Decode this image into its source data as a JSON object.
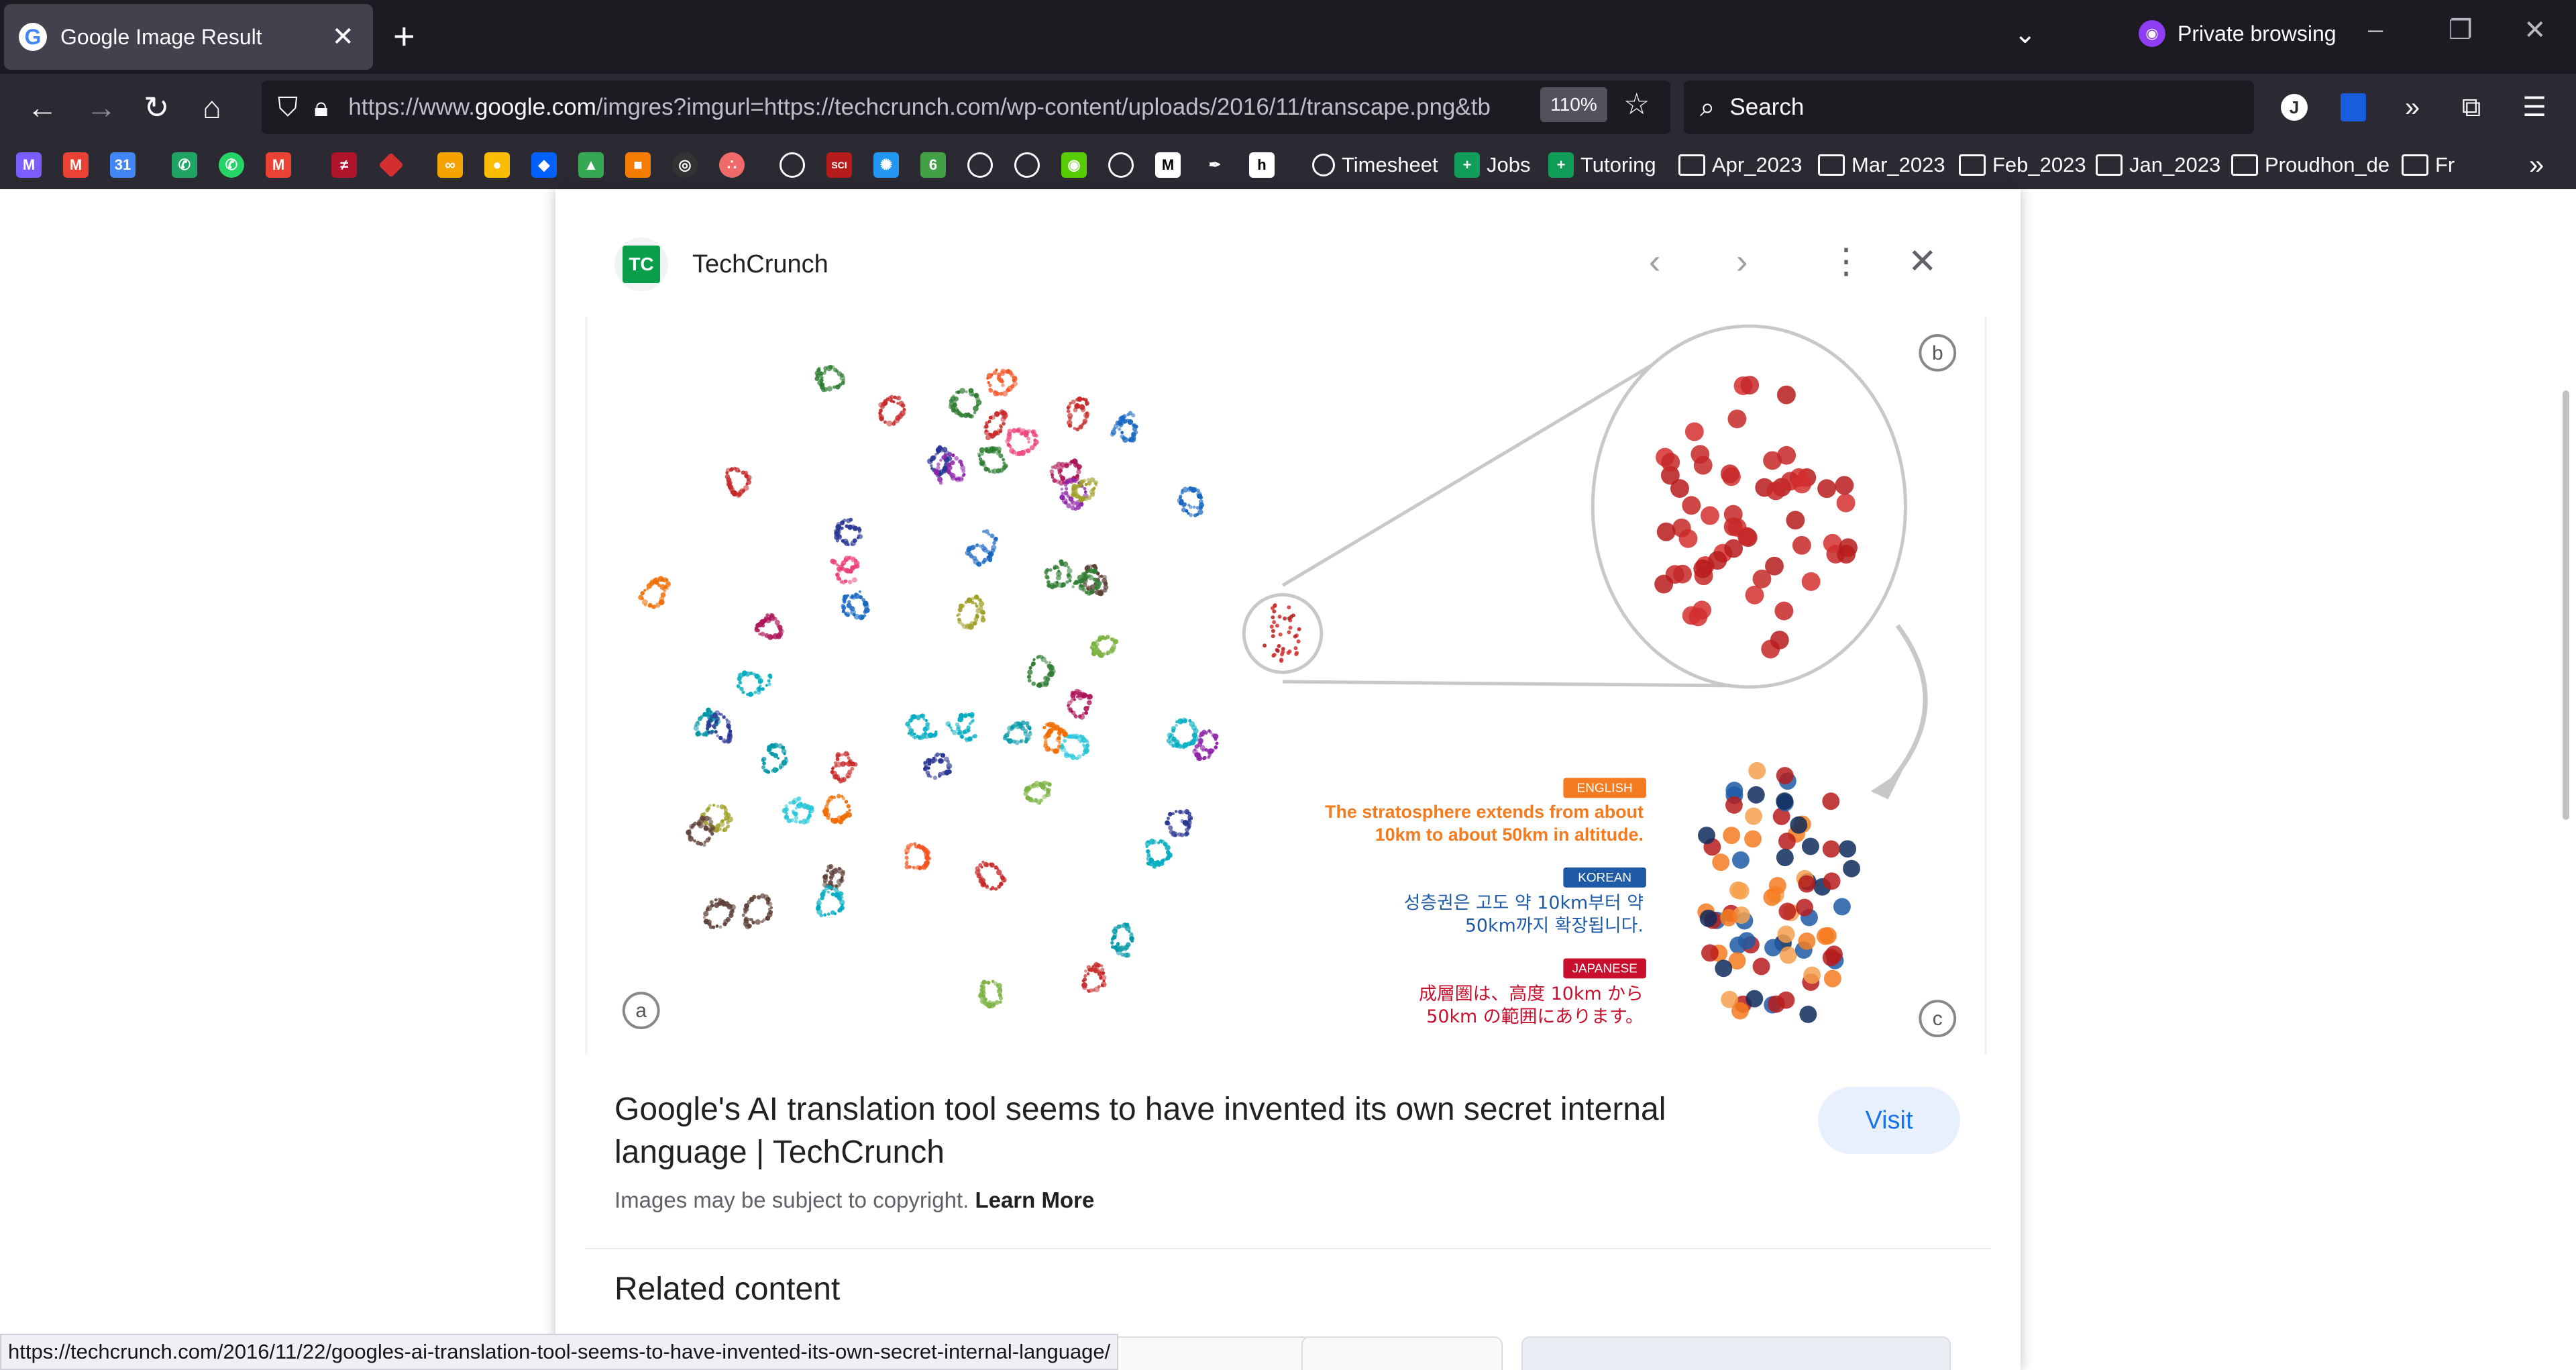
{
  "browser": {
    "tab_title": "Google Image Result",
    "tab_close": "✕",
    "new_tab": "+",
    "private_label": "Private browsing",
    "url_prefix": "https://www.",
    "url_domain": "google.com",
    "url_rest": "/imgres?imgurl=https://techcrunch.com/wp-content/uploads/2016/11/transcape.png&tb",
    "zoom": "110%",
    "search_placeholder": "Search",
    "bookmarks": [
      {
        "label": "Timesheet",
        "type": "globe"
      },
      {
        "label": "Jobs",
        "type": "sheet"
      },
      {
        "label": "Tutoring",
        "type": "sheet"
      },
      {
        "label": "Apr_2023",
        "type": "folder"
      },
      {
        "label": "Mar_2023",
        "type": "folder"
      },
      {
        "label": "Feb_2023",
        "type": "folder"
      },
      {
        "label": "Jan_2023",
        "type": "folder"
      },
      {
        "label": "Proudhon_de",
        "type": "folder"
      },
      {
        "label": "Fr",
        "type": "folder"
      }
    ],
    "status_url": "https://techcrunch.com/2016/11/22/googles-ai-translation-tool-seems-to-have-invented-its-own-secret-internal-language/"
  },
  "card": {
    "source_name": "TechCrunch",
    "source_logo_text": "TC",
    "headline": "Google's AI translation tool seems to have invented its own secret internal language | TechCrunch",
    "visit_label": "Visit",
    "copyright_text": "Images may be subject to copyright.",
    "learn_more": "Learn More",
    "related_title": "Related content"
  },
  "figure": {
    "label_a": "a",
    "label_b": "b",
    "label_c": "c",
    "languages": [
      {
        "tag": "ENGLISH",
        "color": "#f47b20",
        "line1": "The stratosphere extends from about",
        "line2": "10km to about 50km in altitude."
      },
      {
        "tag": "KOREAN",
        "color": "#1f5aa6",
        "line1": "성층권은 고도 약 10km부터 약",
        "line2": "50km까지 확장됩니다."
      },
      {
        "tag": "JAPANESE",
        "color": "#c8102e",
        "line1": "成層圏は、高度 10km から",
        "line2": "50km の範囲にあります。"
      }
    ]
  },
  "colors": {
    "chrome_bg": "#1c1b22",
    "toolbar_bg": "#2b2a33",
    "visit_bg": "#e8f0fe",
    "visit_text": "#1a73e8"
  }
}
